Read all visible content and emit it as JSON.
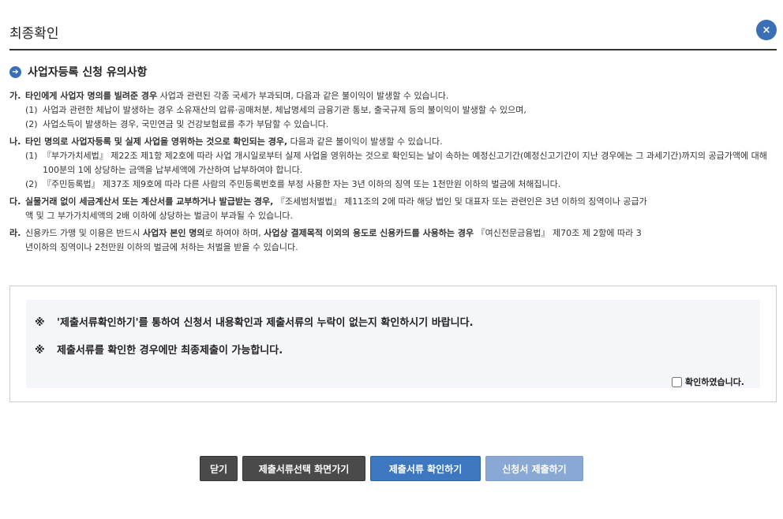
{
  "header": {
    "title": "최종확인",
    "close_label": "×"
  },
  "section": {
    "icon": "arrow-right-icon",
    "arrow": "➔",
    "title": "사업자등록 신청 유의사항"
  },
  "notices": {
    "ga": {
      "letter": "가.",
      "bold": "타인에게 사업자 명의를 빌려준 경우",
      "text": " 사업과 관련된 각종 국세가 부과되며, 다음과 같은 불이익이 발생할 수 있습니다.",
      "items": [
        {
          "num": "(1)",
          "text": "사업과 관련한 체납이 발생하는 경우 소유재산의 압류·공매처분, 체납명세의 금융기관 통보, 출국규제 등의 불이익이 발생할 수 있으며,"
        },
        {
          "num": "(2)",
          "text": "사업소득이 발생하는 경우, 국민연금 및 건강보험료를 추가 부담할 수 있습니다."
        }
      ]
    },
    "na": {
      "letter": "나.",
      "bold": "타인 명의로 사업자등록 및 실제 사업을 영위하는 것으로 확인되는 경우,",
      "text": " 다음과 같은 불이익이 발생할 수 있습니다.",
      "items": [
        {
          "num": "(1)",
          "text": "『부가가치세법』 제22조 제1항 제2호에 따라 사업 개시일로부터 실제 사업을 영위하는 것으로 확인되는 날이 속하는 예정신고기간(예정신고기간이 지난 경우에는 그 과세기간)까지의 공급가액에 대해 100분의 1에 상당하는 금액을 납부세액에 가산하여 납부하여야 합니다."
        },
        {
          "num": "(2)",
          "text": "『주민등록법』 제37조 제9호에 따라 다른 사람의 주민등록번호를 부정 사용한 자는 3년 이하의 징역 또는 1천만원 이하의 벌금에 처해집니다."
        }
      ]
    },
    "da": {
      "letter": "다.",
      "bold": "실물거래 없이 세금계산서 또는 계산서를 교부하거나 발급받는 경우,",
      "text": " 『조세범처벌법』 제11조의 2에 따라 해당 법인 및 대표자 또는 관련인은 3년 이하의 징역이나 공급가",
      "cont": "액 및 그 부가가치세액의 2배 이하에 상당하는 벌금이 부과될 수 있습니다."
    },
    "ra": {
      "letter": "라.",
      "text1": " 신용카드 가맹 및 이용은 반드시 ",
      "bold1": "사업자 본인 명의",
      "text2": "로 하여야 하며, ",
      "bold2": "사업상 결제목적 이외의 용도로 신용카드를 사용하는 경우",
      "text3": " 『여신전문금융법』 제70조 제 2항에 따라 3",
      "cont": "년이하의 징역이나 2천만원 이하의 벌금에 처하는 처벌을 받을 수 있습니다."
    }
  },
  "confirm": {
    "mark": "※",
    "line1": "'제출서류확인하기'를 통하여 신청서 내용확인과 제출서류의 누락이 없는지 확인하시기 바랍니다.",
    "line2": "제출서류를 확인한 경우에만 최종제출이 가능합니다.",
    "checkbox_label": "확인하였습니다.",
    "checked": false
  },
  "buttons": {
    "close": "닫기",
    "go_select": "제출서류선택 화면가기",
    "check_docs": "제출서류 확인하기",
    "submit": "신청서 제출하기"
  },
  "colors": {
    "accent": "#3b6fb5",
    "dark_button": "#4a4a4a",
    "blue_button": "#3d77c0",
    "disabled_button": "#8aa8d4"
  }
}
